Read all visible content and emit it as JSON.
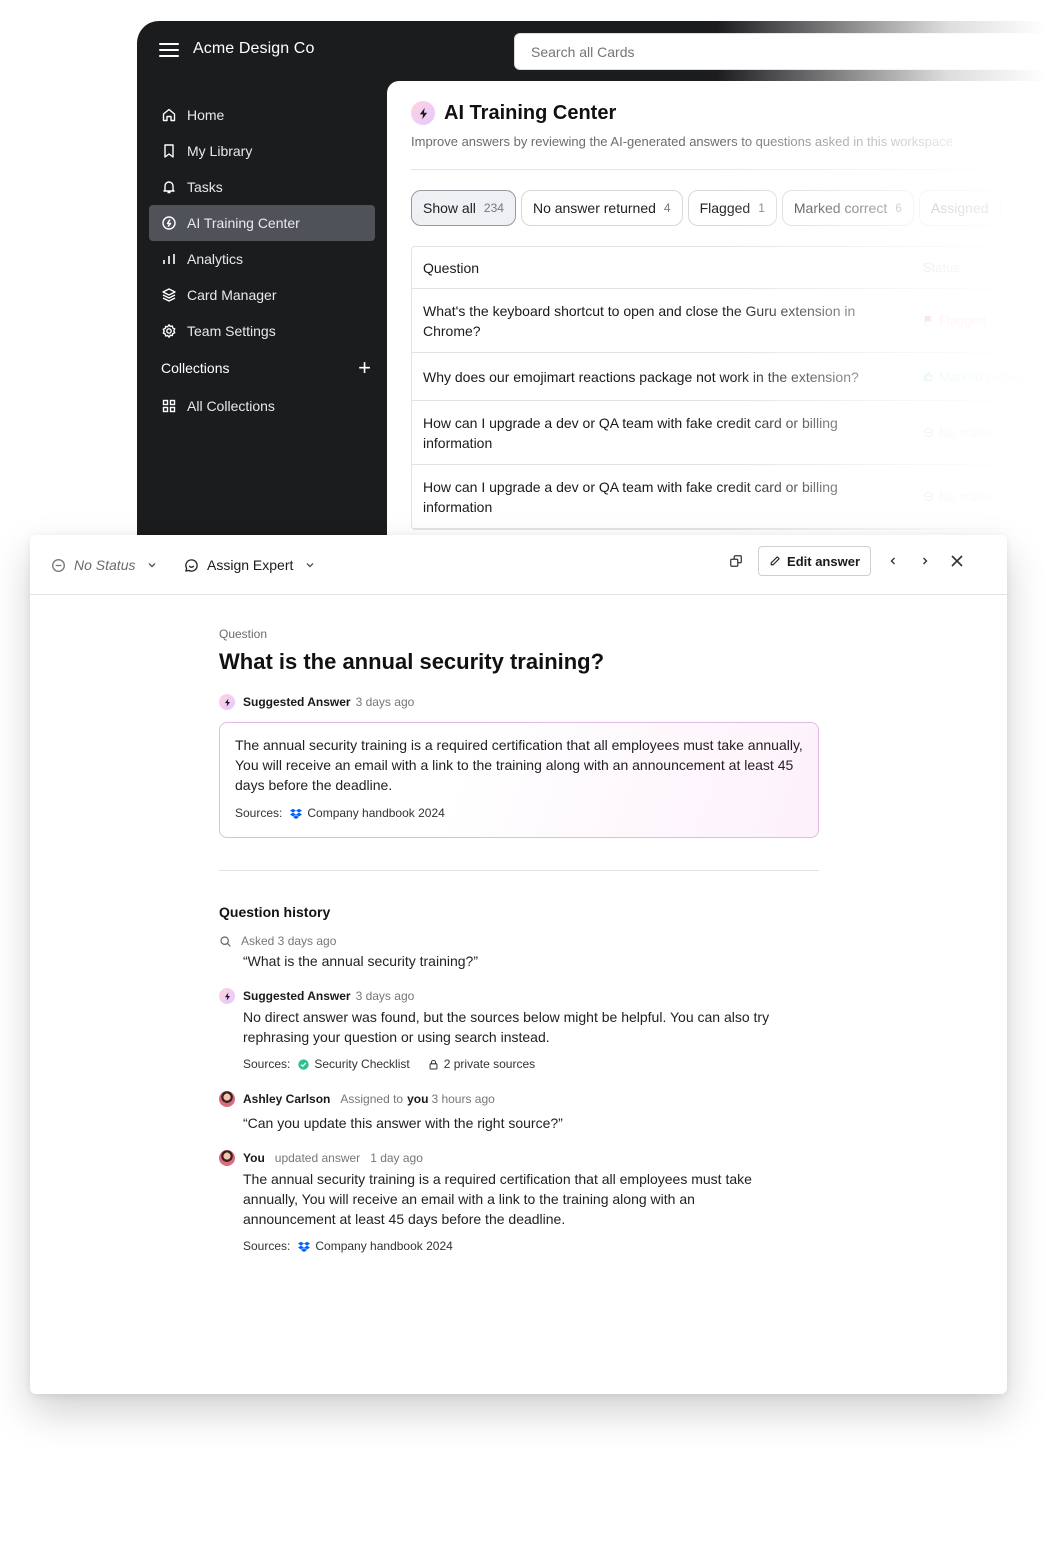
{
  "app": {
    "brand": "Acme Design Co",
    "search_placeholder": "Search all Cards",
    "nav": [
      {
        "label": "Home",
        "icon": "home-icon"
      },
      {
        "label": "My Library",
        "icon": "bookmark-icon"
      },
      {
        "label": "Tasks",
        "icon": "bell-icon"
      },
      {
        "label": "AI Training Center",
        "icon": "ai-icon",
        "active": true
      },
      {
        "label": "Analytics",
        "icon": "bar-chart-icon"
      },
      {
        "label": "Card Manager",
        "icon": "layers-icon"
      },
      {
        "label": "Team Settings",
        "icon": "gear-icon"
      }
    ],
    "collections_label": "Collections",
    "all_collections": "All Collections"
  },
  "panel": {
    "title": "AI Training Center",
    "subtitle": "Improve answers by reviewing the AI-generated answers to questions asked in this workspace",
    "chips": [
      {
        "label": "Show all",
        "count": "234"
      },
      {
        "label": "No answer returned",
        "count": "4"
      },
      {
        "label": "Flagged",
        "count": "1"
      },
      {
        "label": "Marked correct",
        "count": "6"
      },
      {
        "label": "Assigned",
        "count": ""
      }
    ],
    "table": {
      "col_question": "Question",
      "col_status": "Status",
      "rows": [
        {
          "q": "What's the keyboard shortcut to open and close the Guru extension in Chrome?",
          "status": "Flagged"
        },
        {
          "q": "Why does our emojimart reactions package not work in the extension?",
          "status": "Marked correct"
        },
        {
          "q": "How can I upgrade a dev or QA team with fake credit card or billing information",
          "status": "No status"
        },
        {
          "q": "How can I upgrade a dev or QA team with fake credit card or billing information",
          "status": "No status"
        }
      ]
    }
  },
  "modal": {
    "status": "No Status",
    "assign": "Assign Expert",
    "edit_label": "Edit answer",
    "question_label": "Question",
    "question": "What is the annual security training?",
    "suggested_label": "Suggested Answer",
    "suggested_time": "3 days ago",
    "answer": "The annual security training is a required certification that all employees must take annually, You will receive an email with a link to the training along with an announcement at least 45 days before the deadline.",
    "sources_label": "Sources:",
    "source_1": "Company handbook 2024",
    "history_title": "Question history",
    "history": {
      "asked_label": "Asked 3 days ago",
      "asked_text": "“What is the annual security training?”",
      "sugg_label": "Suggested Answer",
      "sugg_time": "3 days ago",
      "sugg_text": "No direct answer was found, but the sources below might be helpful. You can also try rephrasing your question or using search instead.",
      "sugg_source_1": "Security Checklist",
      "sugg_source_2": "2 private sources",
      "assign_name": "Ashley Carlson",
      "assign_pre": "Assigned to",
      "assign_you": "you",
      "assign_time": "3 hours ago",
      "assign_text": "“Can you update this answer with the right source?”",
      "update_name": "You",
      "update_action": "updated answer",
      "update_time": "1 day ago",
      "update_text": "The annual security training is a required certification that all employees must take annually, You will receive an email with a link to the training along with an announcement at least 45 days before the deadline.",
      "update_source": "Company handbook 2024"
    }
  },
  "colors": {
    "sidebar_bg": "#1b1c1e",
    "nav_active": "#50525a",
    "answer_border": "#e4b8e8",
    "dropbox_blue": "#0061fe",
    "verified_green": "#2fbf8f",
    "flag_red": "#f28b9b"
  }
}
